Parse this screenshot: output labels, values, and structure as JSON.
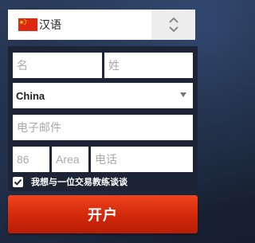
{
  "language_selector": {
    "label": "汉语",
    "flag_icon": "china-flag-icon",
    "arrow_icon": "up-down-chevron-icon"
  },
  "form": {
    "first_name_placeholder": "名",
    "last_name_placeholder": "姓",
    "country_value": "China",
    "email_placeholder": "电子邮件",
    "phone_country_code": "86",
    "area_placeholder": "Area",
    "phone_placeholder": "电话",
    "consent_label": "我想与一位交易教练谈谈",
    "consent_checked": true,
    "submit_label": "开户"
  },
  "colors": {
    "accent": "#d9310f",
    "panel": "#1c2435"
  }
}
